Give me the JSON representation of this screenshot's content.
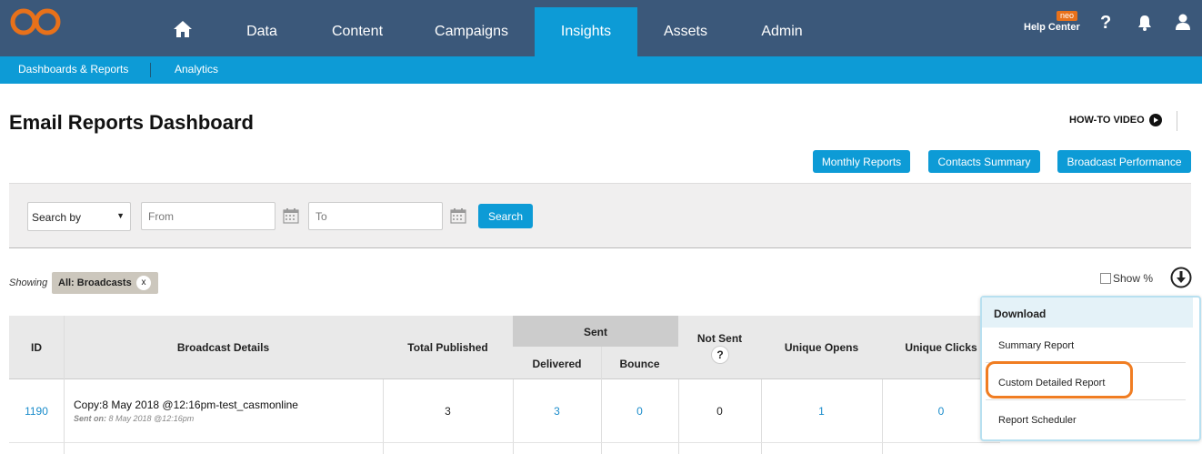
{
  "nav": {
    "items": [
      {
        "label": "Data"
      },
      {
        "label": "Content"
      },
      {
        "label": "Campaigns"
      },
      {
        "label": "Insights"
      },
      {
        "label": "Assets"
      },
      {
        "label": "Admin"
      }
    ],
    "active": "Insights",
    "help_center": "Help Center",
    "help_badge": "neo",
    "icons": [
      "home-icon",
      "question-icon",
      "bell-icon",
      "user-icon"
    ]
  },
  "subnav": {
    "items": [
      {
        "label": "Dashboards & Reports"
      },
      {
        "label": "Analytics"
      }
    ]
  },
  "page": {
    "title": "Email Reports Dashboard",
    "howto": "HOW-TO VIDEO",
    "buttons": {
      "monthly": "Monthly Reports",
      "contacts": "Contacts Summary",
      "broadcast": "Broadcast Performance"
    }
  },
  "search": {
    "select_value": "Search by",
    "from_placeholder": "From",
    "to_placeholder": "To",
    "button": "Search"
  },
  "filter": {
    "showing": "Showing",
    "chip": "All: Broadcasts",
    "chip_close": "x",
    "show_pct": "Show %"
  },
  "table": {
    "headers": {
      "id": "ID",
      "details": "Broadcast Details",
      "total": "Total Published",
      "sent": "Sent",
      "delivered": "Delivered",
      "bounce": "Bounce",
      "not_sent": "Not Sent",
      "not_sent_help": "?",
      "opens": "Unique Opens",
      "clicks": "Unique Clicks"
    },
    "rows": [
      {
        "id": "1190",
        "title": "Copy:8 May 2018 @12:16pm-test_casmonline",
        "sent_on_label": "Sent on:",
        "sent_on_value": "8 May 2018 @12:16pm",
        "total": "3",
        "delivered": "3",
        "bounce": "0",
        "not_sent": "0",
        "opens": "1",
        "clicks": "0"
      }
    ]
  },
  "download_menu": {
    "header": "Download",
    "items": [
      {
        "label": "Summary Report"
      },
      {
        "label": "Custom Detailed Report"
      },
      {
        "label": "Report Scheduler"
      }
    ],
    "highlighted": "Custom Detailed Report"
  },
  "colors": {
    "nav_bg": "#3b587a",
    "accent": "#0d9bd6",
    "logo": "#e8711a",
    "highlight": "#f07d22"
  }
}
